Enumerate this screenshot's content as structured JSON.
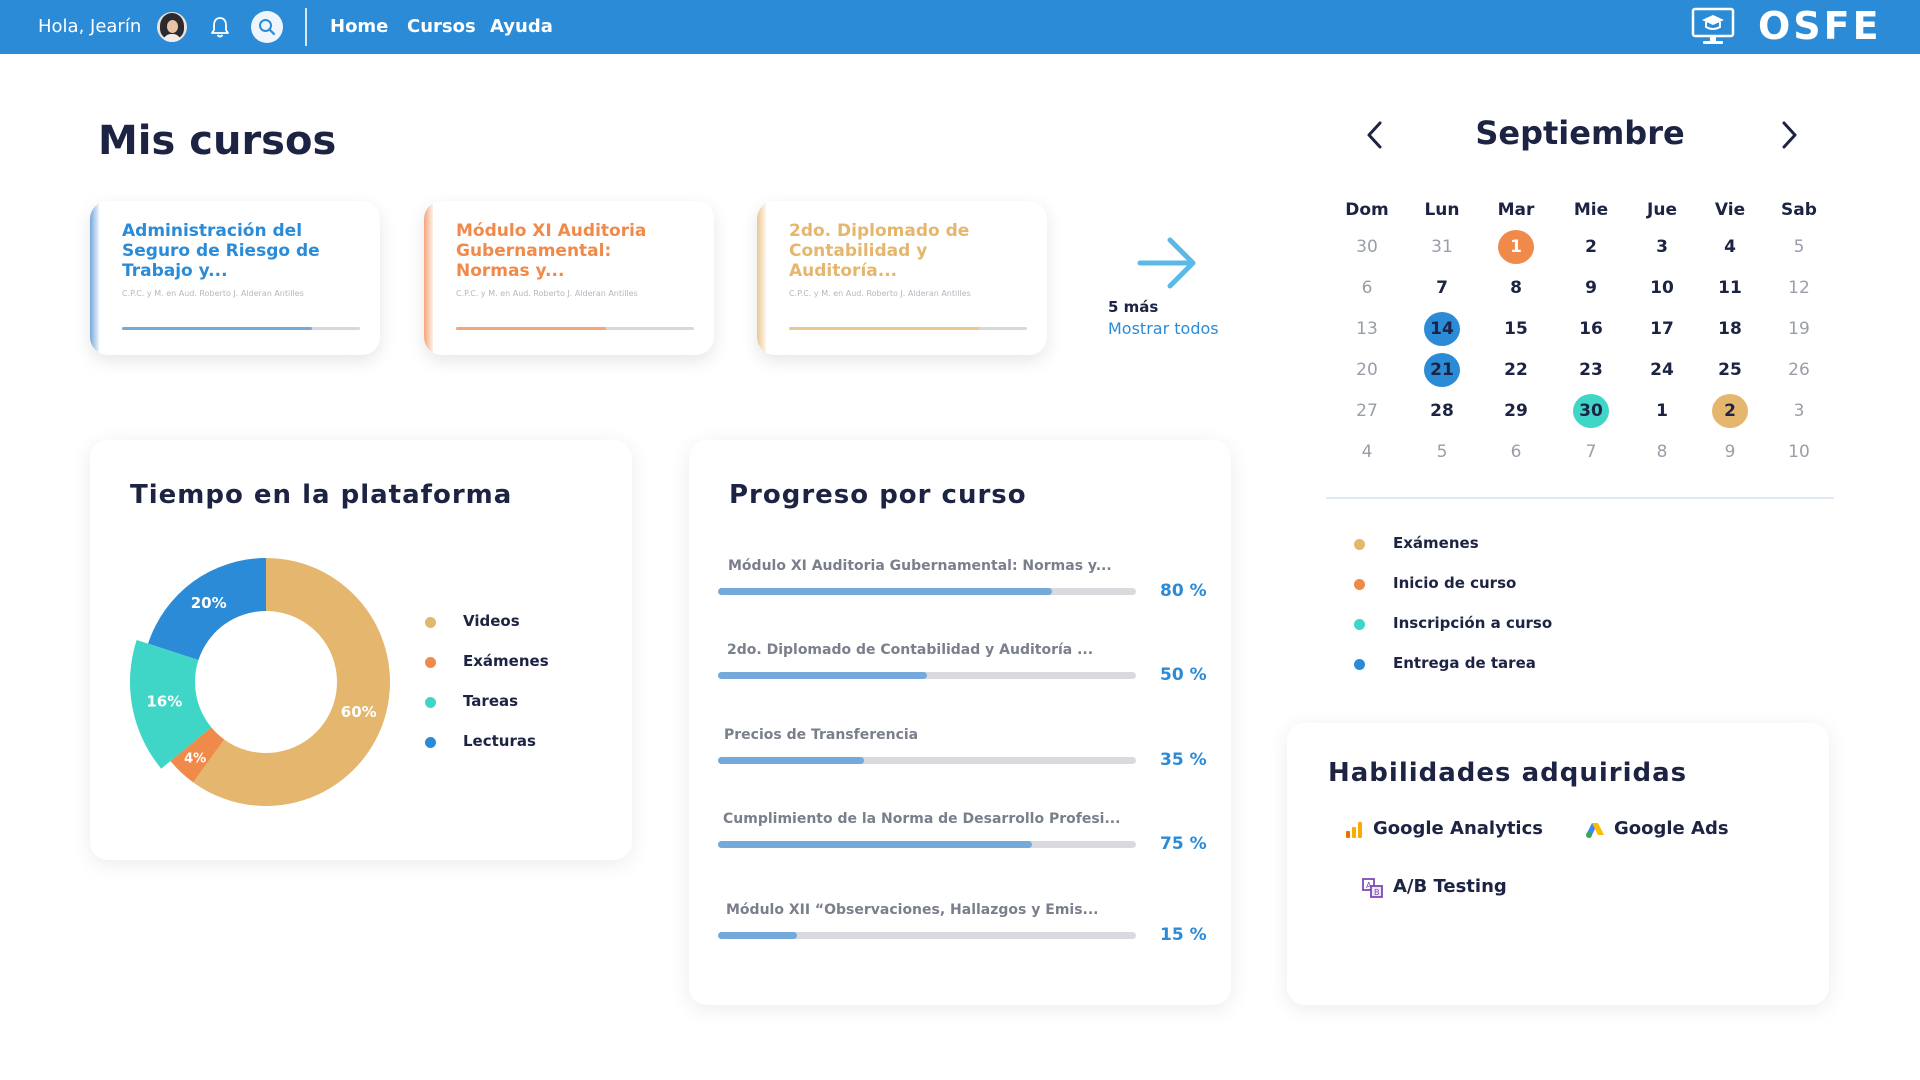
{
  "header": {
    "greeting": "Hola, Jearín",
    "nav": [
      "Home",
      "Cursos",
      "Ayuda"
    ],
    "brand": "OSFE",
    "bar_color": "#2b8bd6",
    "icons": [
      "avatar",
      "bell-icon",
      "search-icon",
      "monitor-graduation-icon"
    ]
  },
  "courses": {
    "title": "Mis cursos",
    "items": [
      {
        "title": "Administración del Seguro de Riesgo de Trabajo y...",
        "teacher": "C.P.C. y M. en Aud. Roberto J. Alderan Antilles",
        "progress": 0.8,
        "color": "#2b8bd6"
      },
      {
        "title": "Módulo XI Auditoria Gubernamental: Normas y...",
        "teacher": "C.P.C. y M. en Aud. Roberto J. Alderan Antilles",
        "progress": 0.63,
        "color": "#f08a4b"
      },
      {
        "title": "2do. Diplomado de Contabilidad y Auditoría...",
        "teacher": "C.P.C. y M. en Aud. Roberto J. Alderan Antilles",
        "progress": 0.8,
        "color": "#e4b66e"
      }
    ],
    "more_count": "5 más",
    "show_all": "Mostrar todos"
  },
  "time_panel": {
    "title": "Tiempo en la plataforma",
    "chart_data": {
      "type": "pie",
      "labels": [
        "Videos",
        "Exámenes",
        "Tareas",
        "Lecturas"
      ],
      "values": [
        60,
        4,
        16,
        20
      ],
      "value_labels": [
        "60%",
        "4%",
        "16%",
        "20%"
      ],
      "colors": [
        "#e4b66e",
        "#f08a4b",
        "#3fd6c8",
        "#2b8bd6"
      ],
      "legend": "right"
    }
  },
  "progress_panel": {
    "title": "Progreso por curso",
    "items": [
      {
        "label": "Módulo XI Auditoria Gubernamental: Normas y...",
        "value": 0.8,
        "pct": "80 %"
      },
      {
        "label": "2do. Diplomado de Contabilidad y Auditoría ...",
        "value": 0.5,
        "pct": "50 %"
      },
      {
        "label": "Precios de Transferencia",
        "value": 0.35,
        "pct": "35 %"
      },
      {
        "label": "Cumplimiento de la Norma de Desarrollo Profesi...",
        "value": 0.75,
        "pct": "75 %"
      },
      {
        "label": "Módulo XII “Observaciones, Hallazgos y Emis...",
        "value": 0.15,
        "pct": "15 %"
      }
    ]
  },
  "calendar": {
    "month": "Septiembre",
    "weekdays": [
      "Dom",
      "Lun",
      "Mar",
      "Mie",
      "Jue",
      "Vie",
      "Sab"
    ],
    "weeks": [
      [
        {
          "d": "30",
          "m": "other"
        },
        {
          "d": "31",
          "m": "other"
        },
        {
          "d": "1",
          "mark": "inicio"
        },
        {
          "d": "2"
        },
        {
          "d": "3"
        },
        {
          "d": "4"
        },
        {
          "d": "5",
          "m": "other"
        }
      ],
      [
        {
          "d": "6",
          "m": "other"
        },
        {
          "d": "7"
        },
        {
          "d": "8"
        },
        {
          "d": "9"
        },
        {
          "d": "10"
        },
        {
          "d": "11"
        },
        {
          "d": "12",
          "m": "other"
        }
      ],
      [
        {
          "d": "13",
          "m": "other"
        },
        {
          "d": "14",
          "mark": "entrega"
        },
        {
          "d": "15"
        },
        {
          "d": "16"
        },
        {
          "d": "17"
        },
        {
          "d": "18"
        },
        {
          "d": "19",
          "m": "other"
        }
      ],
      [
        {
          "d": "20",
          "m": "other"
        },
        {
          "d": "21",
          "mark": "entrega"
        },
        {
          "d": "22"
        },
        {
          "d": "23"
        },
        {
          "d": "24"
        },
        {
          "d": "25"
        },
        {
          "d": "26",
          "m": "other"
        }
      ],
      [
        {
          "d": "27",
          "m": "other"
        },
        {
          "d": "28"
        },
        {
          "d": "29"
        },
        {
          "d": "30",
          "mark": "inscripcion"
        },
        {
          "d": "1"
        },
        {
          "d": "2",
          "mark": "examen"
        },
        {
          "d": "3",
          "m": "other"
        }
      ],
      [
        {
          "d": "4",
          "m": "other"
        },
        {
          "d": "5",
          "m": "other"
        },
        {
          "d": "6",
          "m": "other"
        },
        {
          "d": "7",
          "m": "other"
        },
        {
          "d": "8",
          "m": "other"
        },
        {
          "d": "9",
          "m": "other"
        },
        {
          "d": "10",
          "m": "other"
        }
      ]
    ],
    "legend": [
      {
        "label": "Exámenes",
        "color": "#e4b66e"
      },
      {
        "label": "Inicio de curso",
        "color": "#f08a4b"
      },
      {
        "label": "Inscripción a curso",
        "color": "#3fd6c8"
      },
      {
        "label": "Entrega de tarea",
        "color": "#2b8bd6"
      }
    ]
  },
  "skills": {
    "title": "Habilidades adquiridas",
    "items": [
      "Google Analytics",
      "Google Ads",
      "A/B Testing"
    ]
  }
}
